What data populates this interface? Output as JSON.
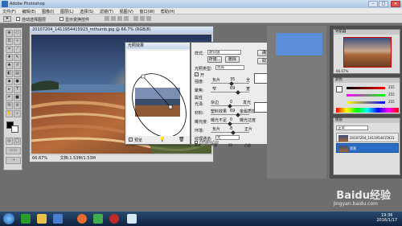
{
  "app": {
    "title": "Adobe Photoshop"
  },
  "menu": [
    "文件(F)",
    "编辑(E)",
    "图像(I)",
    "图层(L)",
    "选择(S)",
    "滤镜(T)",
    "视图(V)",
    "窗口(W)",
    "帮助(H)"
  ],
  "options_bar": {
    "auto_select": "自动选择图层",
    "show_transform": "显示变换控件"
  },
  "document": {
    "title": "20107204_1411954415923_mthumb.jpg @ 66.7% (RGB/8)",
    "zoom": "66.67%",
    "doc_size": "文档:1.53M/1.53M"
  },
  "filter_dialog": {
    "title": "光照效果",
    "preview_label": "预览"
  },
  "lighting_dialog": {
    "style_label": "样式:",
    "style_value": "默认值",
    "save_button": "存储...",
    "delete_button": "删除",
    "ok_button": "确定",
    "cancel_button": "取消",
    "light_type_label": "光照类型:",
    "light_type_value": "点光",
    "on_label": "开",
    "intensity_label": "强度:",
    "intensity_min": "负片",
    "intensity_value": "35",
    "intensity_max": "全",
    "focus_label": "聚焦:",
    "focus_min": "窄",
    "focus_value": "69",
    "focus_max": "宽",
    "properties_section": "属性",
    "gloss_label": "光泽:",
    "gloss_min": "杂边",
    "gloss_value": "0",
    "gloss_max": "发光",
    "material_label": "材料:",
    "material_min": "塑料效果",
    "material_value": "69",
    "material_max": "金属质感",
    "exposure_label": "曝光度:",
    "exposure_min": "曝光不足",
    "exposure_value": "0",
    "exposure_max": "曝光过度",
    "ambience_label": "环境:",
    "ambience_min": "负片",
    "ambience_value": "8",
    "ambience_max": "正片",
    "texture_label": "纹理通道:",
    "texture_value": "无",
    "white_high_label": "白色部分凸出",
    "height_label": "高度:",
    "height_min": "平滑",
    "height_value": "50",
    "height_max": "凸起"
  },
  "right_panels": {
    "navigator_tab": "导航器",
    "navigator_zoom": "66.67%",
    "color_tab": "颜色",
    "color_values": [
      "255",
      "255",
      "255"
    ],
    "layers_tab": "图层",
    "layer_name_1": "20107204_1411954415923",
    "layer_name_2": "背景",
    "layers_small_label": "正常"
  },
  "watermark": {
    "brand": "Baidu经验",
    "url": "jingyan.baidu.com"
  },
  "taskbar": {
    "time": "19:36",
    "date": "2016/1/17"
  },
  "colors": {
    "taskbar": "#0e2340",
    "dialog_bg": "#ececec",
    "accent": "#2b6cc4"
  }
}
